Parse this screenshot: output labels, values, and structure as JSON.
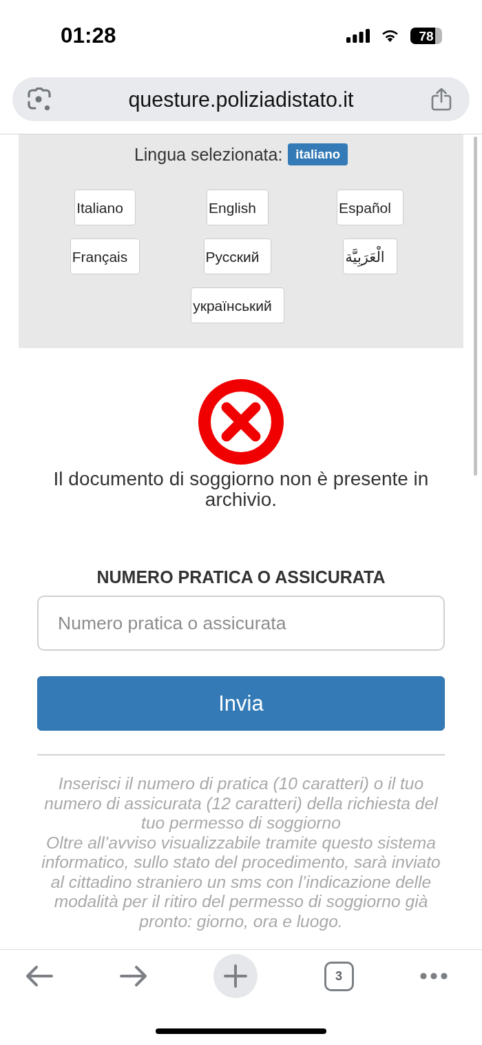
{
  "status_bar": {
    "time": "01:28",
    "battery": "78"
  },
  "address_bar": {
    "url": "questure.poliziadistato.it"
  },
  "language_panel": {
    "label": "Lingua selezionata:",
    "current_language": "italiano",
    "languages": [
      "Italiano",
      "English",
      "Español",
      "Français",
      "Русский",
      "الْعَرَبِيَّة",
      "український"
    ]
  },
  "result": {
    "kind": "error",
    "message": "Il documento di soggiorno non è presente in archivio."
  },
  "form": {
    "label": "NUMERO PRATICA O ASSICURATA",
    "input": {
      "placeholder": "Numero pratica o assicurata"
    },
    "submit_button": "Invia"
  },
  "notes": [
    "Inserisci il numero di pratica (10 caratteri) o il tuo numero di assicurata (12 caratteri) della richiesta del tuo permesso di soggiorno",
    "Oltre all’avviso visualizzabile tramite questo sistema informatico, sullo stato del procedimento, sarà inviato al cittadino straniero un sms con l’indicazione delle modalità per il ritiro del permesso di soggiorno già pronto: giorno, ora e luogo."
  ],
  "bottom_toolbar": {
    "tab_count": "3"
  }
}
